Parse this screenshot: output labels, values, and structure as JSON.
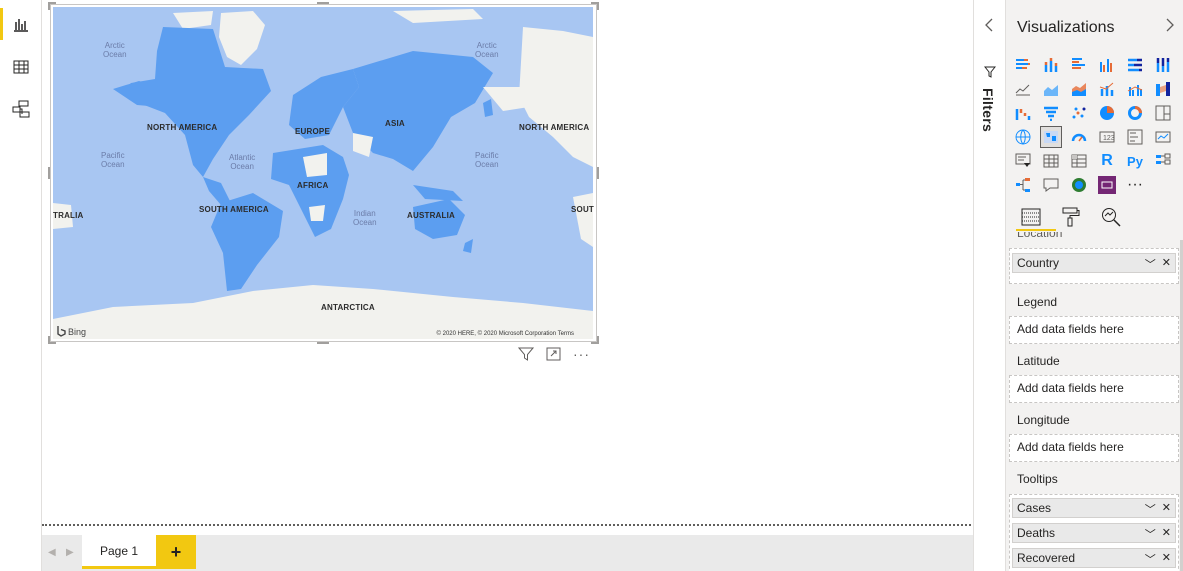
{
  "nav": {
    "items": [
      {
        "name": "report-view",
        "icon": "bar-chart-icon"
      },
      {
        "name": "data-view",
        "icon": "table-icon"
      },
      {
        "name": "model-view",
        "icon": "model-icon"
      }
    ]
  },
  "map": {
    "labels": {
      "arctic_left": "Arctic\nOcean",
      "arctic_right": "Arctic\nOcean",
      "pacific_left": "Pacific\nOcean",
      "pacific_right": "Pacific\nOcean",
      "atlantic": "Atlantic\nOcean",
      "indian": "Indian\nOcean",
      "north_america": "NORTH AMERICA",
      "north_america_2": "NORTH AMERICA",
      "south_america": "SOUTH AMERICA",
      "europe": "EUROPE",
      "asia": "ASIA",
      "africa": "AFRICA",
      "australia": "AUSTRALIA",
      "antarctica": "ANTARCTICA",
      "tralia": "TRALIA",
      "sout": "SOUT"
    },
    "bing": "Bing",
    "copyright": "© 2020 HERE, © 2020 Microsoft Corporation Terms",
    "colors": {
      "water": "#a8c6f2",
      "land": "#f2f2ee",
      "highlight": "#5c9ef0"
    }
  },
  "tabs": {
    "page1": "Page 1",
    "add": "+"
  },
  "filters": {
    "title": "Filters"
  },
  "viz": {
    "title": "Visualizations",
    "sections": {
      "location": "Location",
      "legend": "Legend",
      "latitude": "Latitude",
      "longitude": "Longitude",
      "tooltips": "Tooltips"
    },
    "location_field": "Country",
    "empty_placeholder": "Add data fields here",
    "tooltip_fields": [
      "Cases",
      "Deaths",
      "Recovered"
    ],
    "icons": [
      "stacked-bar-icon",
      "stacked-column-icon",
      "clustered-bar-icon",
      "clustered-column-icon",
      "100-bar-icon",
      "100-column-icon",
      "line-chart-icon",
      "area-chart-icon",
      "stacked-area-icon",
      "line-column-icon",
      "line-clustered-icon",
      "ribbon-icon",
      "waterfall-icon",
      "funnel-icon",
      "scatter-icon",
      "pie-icon",
      "donut-icon",
      "treemap-icon",
      "map-icon",
      "filled-map-icon",
      "gauge-icon",
      "card-icon",
      "multirow-card-icon",
      "kpi-icon",
      "slicer-icon",
      "table-icon",
      "matrix-icon",
      "r-visual-icon",
      "python-visual-icon",
      "key-influencers-icon",
      "decomposition-tree-icon",
      "qa-icon",
      "arcgis-icon",
      "powerapps-icon",
      "more-icon"
    ],
    "r_label": "R",
    "py_label": "Py",
    "more_label": "···"
  }
}
